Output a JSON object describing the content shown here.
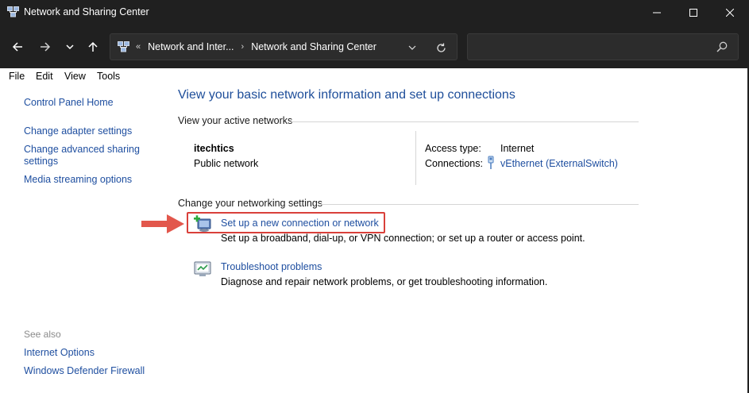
{
  "window": {
    "title": "Network and Sharing Center"
  },
  "nav": {
    "breadcrumb": [
      "Network and Inter...",
      "Network and Sharing Center"
    ],
    "search_placeholder": ""
  },
  "menu": {
    "items": [
      "File",
      "Edit",
      "View",
      "Tools"
    ]
  },
  "sidebar": {
    "links": [
      "Control Panel Home",
      "Change adapter settings",
      "Change advanced sharing settings",
      "Media streaming options"
    ],
    "see_also_label": "See also",
    "see_also_links": [
      "Internet Options",
      "Windows Defender Firewall"
    ]
  },
  "main": {
    "title": "View your basic network information and set up connections",
    "active_networks_label": "View your active networks",
    "network": {
      "name": "itechtics",
      "category": "Public network",
      "access_type_label": "Access type:",
      "access_type_value": "Internet",
      "connections_label": "Connections:",
      "connection_value": "vEthernet (ExternalSwitch)"
    },
    "change_settings_label": "Change your networking settings",
    "tasks": [
      {
        "title": "Set up a new connection or network",
        "description": "Set up a broadband, dial-up, or VPN connection; or set up a router or access point.",
        "icon": "new-connection-icon"
      },
      {
        "title": "Troubleshoot problems",
        "description": "Diagnose and repair network problems, or get troubleshooting information.",
        "icon": "troubleshoot-icon"
      }
    ]
  },
  "colors": {
    "titlebar_bg": "#202020",
    "link": "#1f4fa0",
    "heading": "#1e4e9a",
    "highlight": "#d9403a",
    "arrow": "#e2574c"
  }
}
